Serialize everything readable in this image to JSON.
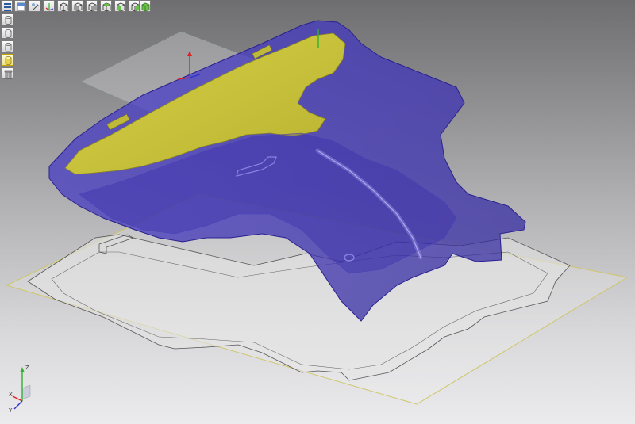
{
  "toolbar": {
    "top_buttons": [
      {
        "name": "menu-icon"
      },
      {
        "name": "view-home-icon"
      },
      {
        "name": "view-edit-icon"
      },
      {
        "name": "view-iso-icon"
      },
      {
        "name": "view-front-icon"
      },
      {
        "name": "view-back-icon"
      },
      {
        "name": "view-left-icon"
      },
      {
        "name": "view-right-icon"
      },
      {
        "name": "view-top-icon"
      },
      {
        "name": "view-bottom-icon"
      },
      {
        "name": "view-solid-icon"
      }
    ],
    "side_buttons": [
      {
        "name": "cylinder-view-icon"
      },
      {
        "name": "cylinder-wire-icon"
      },
      {
        "name": "cylinder-hidden-icon"
      },
      {
        "name": "cylinder-shaded-icon",
        "active": true
      },
      {
        "name": "trash-icon"
      }
    ]
  },
  "triad": {
    "x_label": "X",
    "y_label": "Y",
    "z_label": "Z"
  },
  "colors": {
    "part_blue": "#3a2fb0",
    "part_yellow": "#c8c23a",
    "plane_outline": "#c8c06a",
    "axis_red": "#e02020",
    "axis_green": "#30b030",
    "axis_blue": "#3030d0"
  }
}
